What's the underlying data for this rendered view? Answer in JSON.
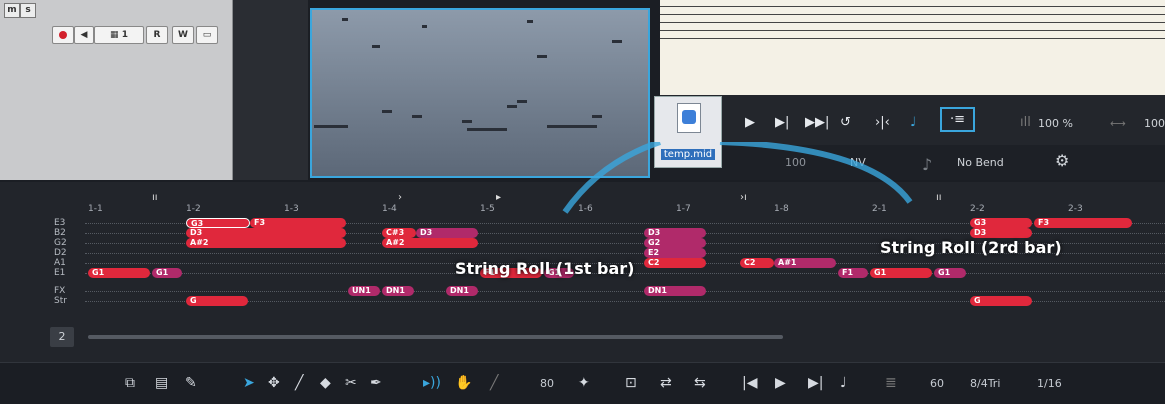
{
  "track": {
    "m_label": "m",
    "s_label": "s",
    "channel": "1",
    "r_label": "R",
    "w_label": "W"
  },
  "transport": {
    "zoom": "100 %",
    "zoom2": "100",
    "tempo": "100",
    "nv": "NV",
    "bend": "No Bend"
  },
  "file": {
    "name": "temp.mid"
  },
  "roll": {
    "strings": [
      "E3",
      "B2",
      "G2",
      "D2",
      "A1",
      "E1",
      "FX",
      "Str"
    ],
    "ruler": [
      "1-1",
      "1-2",
      "1-3",
      "1-4",
      "1-5",
      "1-6",
      "1-7",
      "1-8",
      "2-1",
      "2-2",
      "2-3"
    ],
    "page": "2",
    "callout1": "String Roll (1st bar)",
    "callout2": "String Roll (2rd bar)",
    "notes": [
      "G3",
      "F3",
      "D3",
      "A#2",
      "C#3",
      "D3",
      "A#2",
      "D3",
      "G2",
      "E2",
      "C2",
      "C2",
      "A#1",
      "G1",
      "G1",
      "F1",
      "G1",
      "F1",
      "G1",
      "G1",
      "UN1",
      "DN1",
      "DN1",
      "DN1",
      "G",
      "G",
      "G3",
      "F3",
      "D3",
      "D3"
    ]
  },
  "toolbar": {
    "velocity": "80",
    "tempo": "60",
    "meter": "8/4Tri",
    "quant": "1/16"
  },
  "colors": {
    "note_red": "#e0283c",
    "note_magenta": "#b02a6a",
    "accent": "#3aa6dd"
  }
}
